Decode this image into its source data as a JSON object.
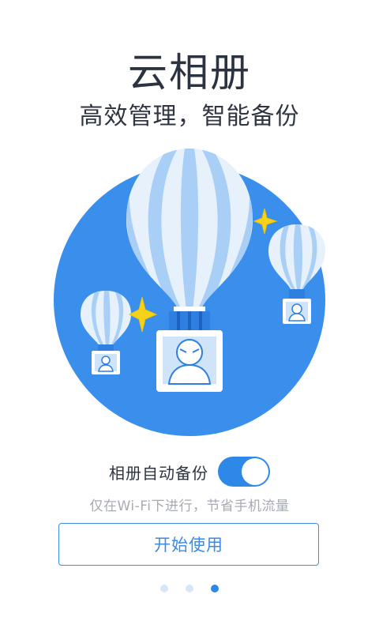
{
  "header": {
    "title": "云相册",
    "subtitle": "高效管理，智能备份"
  },
  "backup_toggle": {
    "label": "相册自动备份",
    "state": "on",
    "hint": "仅在Wi-Fi下进行，节省手机流量"
  },
  "start_button": {
    "label": "开始使用"
  },
  "pager": {
    "total": 3,
    "active_index": 2
  },
  "colors": {
    "accent": "#2d88e8",
    "circle": "#3b8fec",
    "balloon_light": "#e4f0fc",
    "balloon_stripe": "#a9cdf6",
    "sparkle": "#f7d21a",
    "title_text": "#2c3340",
    "hint_text": "#a6abb3"
  }
}
